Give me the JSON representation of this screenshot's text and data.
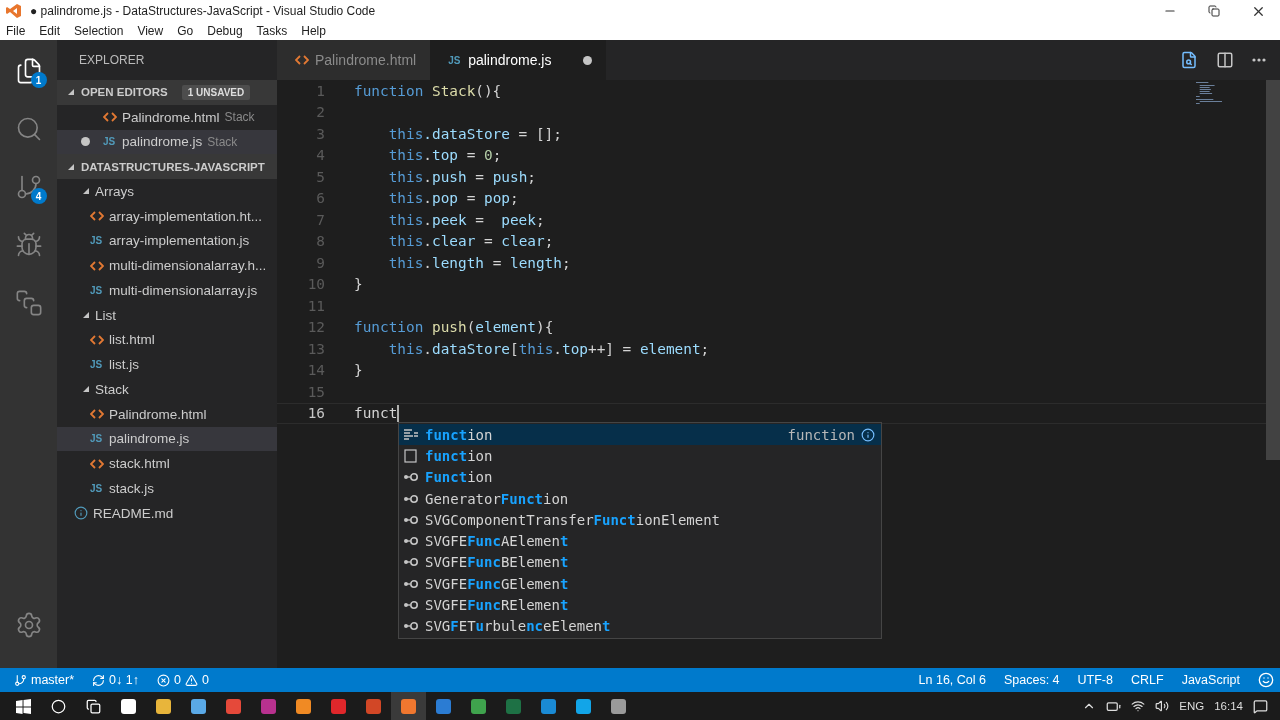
{
  "window": {
    "title": "● palindrome.js - DataStructures-JavaScript - Visual Studio Code"
  },
  "menu": [
    "File",
    "Edit",
    "Selection",
    "View",
    "Go",
    "Debug",
    "Tasks",
    "Help"
  ],
  "activity_bar": [
    {
      "kind": "files",
      "badge": "1",
      "selected": true
    },
    {
      "kind": "search",
      "selected": false
    },
    {
      "kind": "git",
      "badge": "4",
      "selected": false
    },
    {
      "kind": "debug",
      "selected": false
    },
    {
      "kind": "extensions",
      "selected": false
    },
    {
      "kind": "settings",
      "selected": false
    }
  ],
  "sidebar": {
    "title": "EXPLORER",
    "open_editors": {
      "title": "OPEN EDITORS",
      "badge": "1 UNSAVED",
      "expanded": true,
      "items": [
        {
          "name": "Palindrome.html",
          "kind": "html",
          "hint": "Stack",
          "unsaved": false,
          "selected": false
        },
        {
          "name": "palindrome.js",
          "kind": "js",
          "icon_label": "JS",
          "hint": "Stack",
          "unsaved": true,
          "selected": true
        }
      ]
    },
    "folder": {
      "title": "DATASTRUCTURES-JAVASCRIPT",
      "expanded": true,
      "children": [
        {
          "name": "Arrays",
          "kind": "folder",
          "expanded": true,
          "children": [
            {
              "name": "array-implementation.ht...",
              "kind": "html",
              "selected": false
            },
            {
              "name": "array-implementation.js",
              "kind": "js",
              "icon_label": "JS",
              "selected": false
            },
            {
              "name": "multi-dimensionalarray.h...",
              "kind": "html",
              "selected": false
            },
            {
              "name": "multi-dimensionalarray.js",
              "kind": "js",
              "icon_label": "JS",
              "selected": false
            }
          ]
        },
        {
          "name": "List",
          "kind": "folder",
          "expanded": true,
          "children": [
            {
              "name": "list.html",
              "kind": "html",
              "selected": false
            },
            {
              "name": "list.js",
              "kind": "js",
              "icon_label": "JS",
              "selected": false
            }
          ]
        },
        {
          "name": "Stack",
          "kind": "folder",
          "expanded": true,
          "children": [
            {
              "name": "Palindrome.html",
              "kind": "html",
              "selected": false
            },
            {
              "name": "palindrome.js",
              "kind": "js",
              "icon_label": "JS",
              "selected": true
            },
            {
              "name": "stack.html",
              "kind": "html",
              "selected": false
            },
            {
              "name": "stack.js",
              "kind": "js",
              "icon_label": "JS",
              "selected": false
            }
          ]
        },
        {
          "name": "README.md",
          "kind": "info",
          "selected": false
        }
      ]
    }
  },
  "tabs": [
    {
      "name": "Palindrome.html",
      "kind": "html",
      "selected": false,
      "unsaved": false
    },
    {
      "name": "palindrome.js",
      "kind": "js",
      "icon_label": "JS",
      "selected": true,
      "unsaved": true
    }
  ],
  "editor": {
    "lines": [
      {
        "number": "1",
        "current": false,
        "tokens": [
          {
            "text": "function",
            "kind": "keyword"
          },
          {
            "text": " Stack",
            "kind": "function"
          },
          {
            "text": "(){",
            "kind": "plain"
          }
        ]
      },
      {
        "number": "2",
        "current": false
      },
      {
        "number": "3",
        "current": false,
        "tokens": [
          {
            "text": "    this",
            "kind": "keyword"
          },
          {
            "text": ".dataStore",
            "kind": "property"
          },
          {
            "text": " = [];",
            "kind": "plain"
          }
        ]
      },
      {
        "number": "4",
        "current": false,
        "tokens": [
          {
            "text": "    this",
            "kind": "keyword"
          },
          {
            "text": ".",
            "kind": "plain"
          },
          {
            "text": "top",
            "kind": "property"
          },
          {
            "text": " = ",
            "kind": "plain"
          },
          {
            "text": "0",
            "kind": "number"
          },
          {
            "text": ";",
            "kind": "plain"
          }
        ]
      },
      {
        "number": "5",
        "current": false,
        "tokens": [
          {
            "text": "    this",
            "kind": "keyword"
          },
          {
            "text": ".",
            "kind": "plain"
          },
          {
            "text": "push",
            "kind": "property"
          },
          {
            "text": " = ",
            "kind": "plain"
          },
          {
            "text": "push",
            "kind": "variable"
          },
          {
            "text": ";",
            "kind": "plain"
          }
        ]
      },
      {
        "number": "6",
        "current": false,
        "tokens": [
          {
            "text": "    this",
            "kind": "keyword"
          },
          {
            "text": ".",
            "kind": "plain"
          },
          {
            "text": "pop",
            "kind": "property"
          },
          {
            "text": " = ",
            "kind": "plain"
          },
          {
            "text": "pop",
            "kind": "variable"
          },
          {
            "text": ";",
            "kind": "plain"
          }
        ]
      },
      {
        "number": "7",
        "current": false,
        "tokens": [
          {
            "text": "    this",
            "kind": "keyword"
          },
          {
            "text": ".",
            "kind": "plain"
          },
          {
            "text": "peek",
            "kind": "property"
          },
          {
            "text": " =  ",
            "kind": "plain"
          },
          {
            "text": "peek",
            "kind": "variable"
          },
          {
            "text": ";",
            "kind": "plain"
          }
        ]
      },
      {
        "number": "8",
        "current": false,
        "tokens": [
          {
            "text": "    this",
            "kind": "keyword"
          },
          {
            "text": ".",
            "kind": "plain"
          },
          {
            "text": "clear",
            "kind": "property"
          },
          {
            "text": " = ",
            "kind": "plain"
          },
          {
            "text": "clear",
            "kind": "variable"
          },
          {
            "text": ";",
            "kind": "plain"
          }
        ]
      },
      {
        "number": "9",
        "current": false,
        "tokens": [
          {
            "text": "    this",
            "kind": "keyword"
          },
          {
            "text": ".",
            "kind": "plain"
          },
          {
            "text": "length",
            "kind": "property"
          },
          {
            "text": " = ",
            "kind": "plain"
          },
          {
            "text": "length",
            "kind": "variable"
          },
          {
            "text": ";",
            "kind": "plain"
          }
        ]
      },
      {
        "number": "10",
        "current": false,
        "tokens": [
          {
            "text": "}",
            "kind": "plain"
          }
        ]
      },
      {
        "number": "11",
        "current": false
      },
      {
        "number": "12",
        "current": false,
        "tokens": [
          {
            "text": "function",
            "kind": "keyword"
          },
          {
            "text": " push",
            "kind": "function"
          },
          {
            "text": "(",
            "kind": "plain"
          },
          {
            "text": "element",
            "kind": "variable"
          },
          {
            "text": "){",
            "kind": "plain"
          }
        ]
      },
      {
        "number": "13",
        "current": false,
        "tokens": [
          {
            "text": "    this",
            "kind": "keyword"
          },
          {
            "text": ".",
            "kind": "plain"
          },
          {
            "text": "dataStore",
            "kind": "property"
          },
          {
            "text": "[",
            "kind": "plain"
          },
          {
            "text": "this",
            "kind": "keyword"
          },
          {
            "text": ".",
            "kind": "plain"
          },
          {
            "text": "top",
            "kind": "property"
          },
          {
            "text": "++] = ",
            "kind": "plain"
          },
          {
            "text": "element",
            "kind": "variable"
          },
          {
            "text": ";",
            "kind": "plain"
          }
        ]
      },
      {
        "number": "14",
        "current": false,
        "tokens": [
          {
            "text": "}",
            "kind": "plain"
          }
        ]
      },
      {
        "number": "15",
        "current": false
      },
      {
        "number": "16",
        "current": true,
        "tokens": [
          {
            "text": "funct",
            "kind": "plain"
          }
        ]
      }
    ]
  },
  "suggestions": [
    {
      "kind": "snippet",
      "selected": true,
      "detail": "function",
      "segments": [
        {
          "text": "funct",
          "match": true
        },
        {
          "text": "ion",
          "match": false
        }
      ]
    },
    {
      "kind": "keyword",
      "selected": false,
      "segments": [
        {
          "text": "funct",
          "match": true
        },
        {
          "text": "ion",
          "match": false
        }
      ]
    },
    {
      "kind": "class",
      "selected": false,
      "segments": [
        {
          "text": "Funct",
          "match": true
        },
        {
          "text": "ion",
          "match": false
        }
      ]
    },
    {
      "kind": "class",
      "selected": false,
      "segments": [
        {
          "text": "Generator",
          "match": false
        },
        {
          "text": "Funct",
          "match": true
        },
        {
          "text": "ion",
          "match": false
        }
      ]
    },
    {
      "kind": "class",
      "selected": false,
      "segments": [
        {
          "text": "SVGComponentTransfer",
          "match": false
        },
        {
          "text": "Funct",
          "match": true
        },
        {
          "text": "ionElement",
          "match": false
        }
      ]
    },
    {
      "kind": "class",
      "selected": false,
      "segments": [
        {
          "text": "SVGFE",
          "match": false
        },
        {
          "text": "Func",
          "match": true
        },
        {
          "text": "AElemen",
          "match": false
        },
        {
          "text": "t",
          "match": true
        }
      ]
    },
    {
      "kind": "class",
      "selected": false,
      "segments": [
        {
          "text": "SVGFE",
          "match": false
        },
        {
          "text": "Func",
          "match": true
        },
        {
          "text": "BElemen",
          "match": false
        },
        {
          "text": "t",
          "match": true
        }
      ]
    },
    {
      "kind": "class",
      "selected": false,
      "segments": [
        {
          "text": "SVGFE",
          "match": false
        },
        {
          "text": "Func",
          "match": true
        },
        {
          "text": "GElemen",
          "match": false
        },
        {
          "text": "t",
          "match": true
        }
      ]
    },
    {
      "kind": "class",
      "selected": false,
      "segments": [
        {
          "text": "SVGFE",
          "match": false
        },
        {
          "text": "Func",
          "match": true
        },
        {
          "text": "RElemen",
          "match": false
        },
        {
          "text": "t",
          "match": true
        }
      ]
    },
    {
      "kind": "class",
      "selected": false,
      "segments": [
        {
          "text": "SVG",
          "match": false
        },
        {
          "text": "F",
          "match": true
        },
        {
          "text": "ET",
          "match": false
        },
        {
          "text": "u",
          "match": true
        },
        {
          "text": "rbule",
          "match": false
        },
        {
          "text": "nc",
          "match": true
        },
        {
          "text": "eElemen",
          "match": false
        },
        {
          "text": "t",
          "match": true
        }
      ]
    }
  ],
  "status_bar": {
    "branch": "master*",
    "sync": "0↓ 1↑",
    "errors": "0",
    "warnings": "0",
    "position": "Ln 16, Col 6",
    "spaces": "Spaces: 4",
    "encoding": "UTF-8",
    "eol": "CRLF",
    "language": "JavaScript"
  },
  "taskbar": {
    "apps": [
      {
        "color": "#ffffff",
        "selected": false
      },
      {
        "color": "#e8b53b",
        "selected": false
      },
      {
        "color": "#5aa9e6",
        "selected": false
      },
      {
        "color": "#e5493a",
        "selected": false
      },
      {
        "color": "#b8318f",
        "selected": false
      },
      {
        "color": "#f08a24",
        "selected": false
      },
      {
        "color": "#e0272b",
        "selected": false
      },
      {
        "color": "#d24726",
        "selected": false
      },
      {
        "color": "#f0772f",
        "selected": true
      },
      {
        "color": "#2b7cd3",
        "selected": false
      },
      {
        "color": "#3fa34d",
        "selected": false
      },
      {
        "color": "#1e7145",
        "selected": false
      },
      {
        "color": "#1a8ad4",
        "selected": false
      },
      {
        "color": "#12a5e8",
        "selected": false
      },
      {
        "color": "#9a9a9a",
        "selected": false
      }
    ],
    "language": "ENG",
    "time": "16:14"
  }
}
